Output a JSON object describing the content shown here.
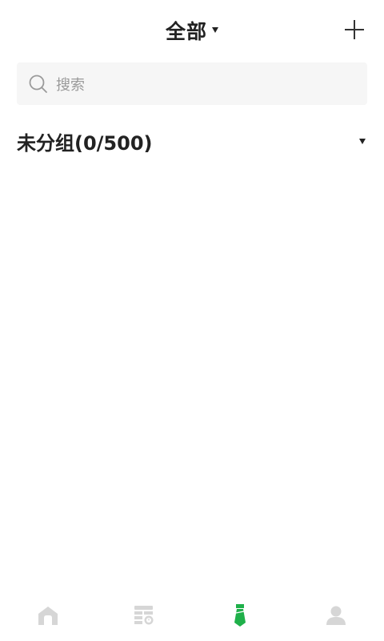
{
  "header": {
    "title": "全部",
    "title_dropdown_icon": "caret-down-icon",
    "add_icon": "plus-icon"
  },
  "search": {
    "icon": "search-icon",
    "placeholder": "搜索"
  },
  "groups": [
    {
      "label": "未分组(0/500)",
      "expand_icon": "caret-down-icon"
    }
  ],
  "tabbar": {
    "tabs": [
      {
        "icon": "home-icon",
        "active": false
      },
      {
        "icon": "calendar-list-icon",
        "active": false
      },
      {
        "icon": "tie-icon",
        "active": true
      },
      {
        "icon": "user-icon",
        "active": false
      }
    ]
  },
  "colors": {
    "accent": "#1fb04a",
    "inactive_icon": "#d6d6d6",
    "text": "#222222",
    "placeholder": "#9a9a9a",
    "search_bg": "#f6f6f6"
  }
}
